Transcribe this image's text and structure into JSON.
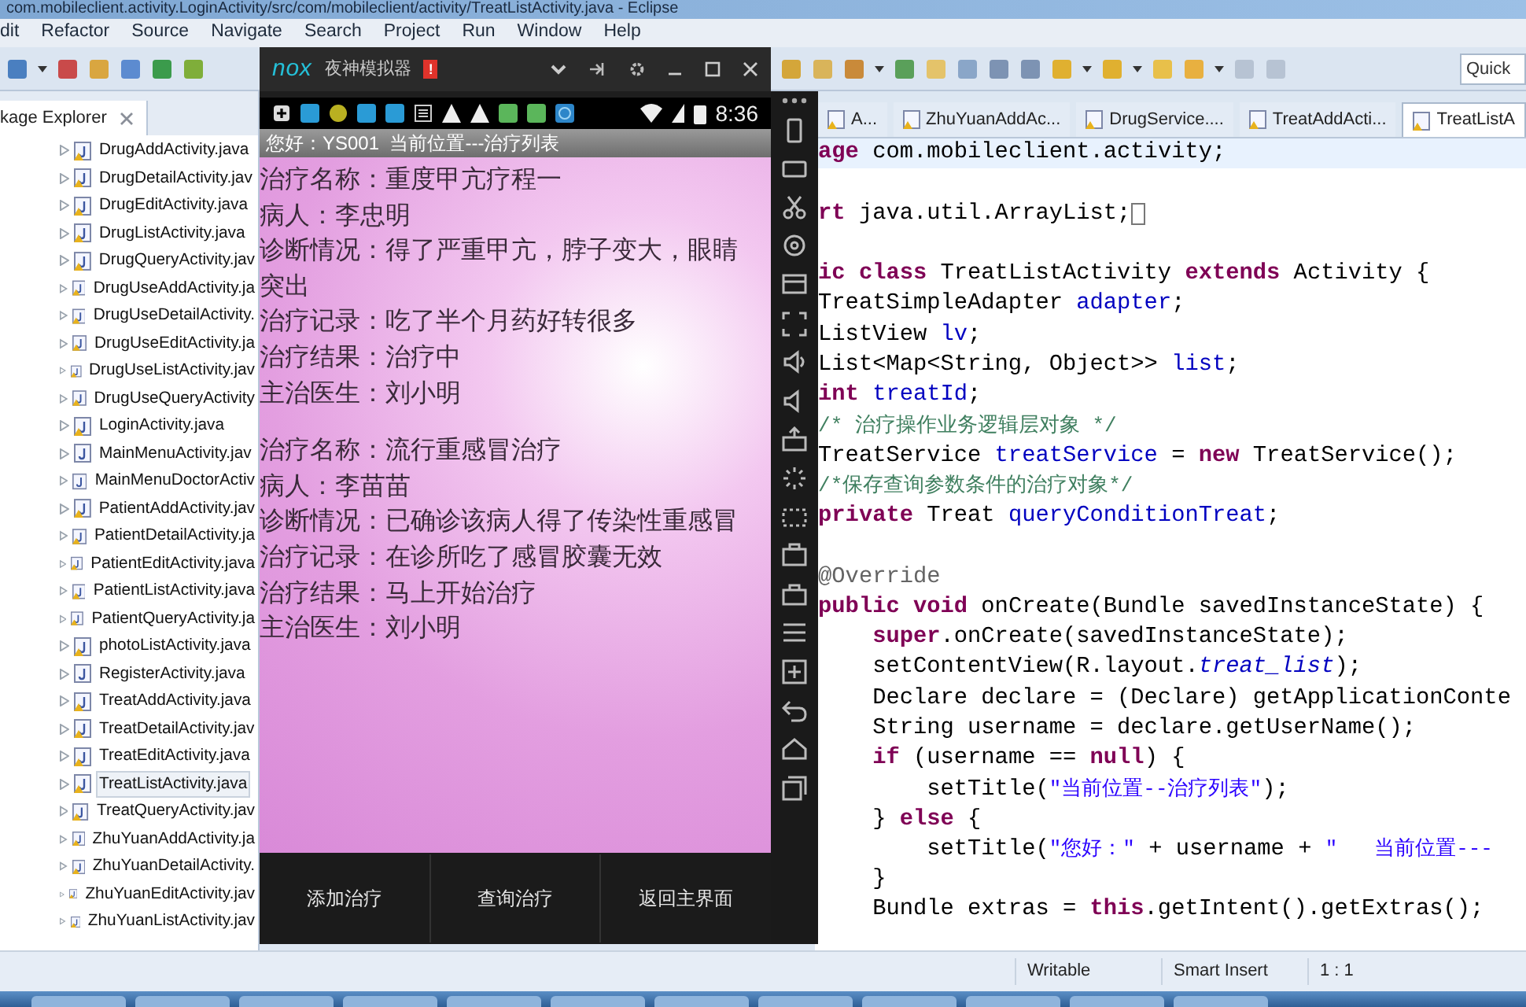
{
  "window": {
    "title": "com.mobileclient.activity.LoginActivity/src/com/mobileclient/activity/TreatListActivity.java - Eclipse"
  },
  "menu": [
    "dit",
    "Refactor",
    "Source",
    "Navigate",
    "Search",
    "Project",
    "Run",
    "Window",
    "Help"
  ],
  "toolbar": {
    "quick_access": {
      "placeholder": "Quick"
    }
  },
  "package_explorer": {
    "title": "kage Explorer",
    "items": [
      {
        "label": "DrugAddActivity.java",
        "selected": false,
        "warning": true
      },
      {
        "label": "DrugDetailActivity.jav",
        "selected": false,
        "warning": true
      },
      {
        "label": "DrugEditActivity.java",
        "selected": false,
        "warning": true
      },
      {
        "label": "DrugListActivity.java",
        "selected": false,
        "warning": true
      },
      {
        "label": "DrugQueryActivity.jav",
        "selected": false,
        "warning": true
      },
      {
        "label": "DrugUseAddActivity.ja",
        "selected": false,
        "warning": true
      },
      {
        "label": "DrugUseDetailActivity.",
        "selected": false,
        "warning": true
      },
      {
        "label": "DrugUseEditActivity.ja",
        "selected": false,
        "warning": true
      },
      {
        "label": "DrugUseListActivity.jav",
        "selected": false,
        "warning": true
      },
      {
        "label": "DrugUseQueryActivity",
        "selected": false,
        "warning": true
      },
      {
        "label": "LoginActivity.java",
        "selected": false,
        "warning": true
      },
      {
        "label": "MainMenuActivity.jav",
        "selected": false,
        "warning": false
      },
      {
        "label": "MainMenuDoctorActiv",
        "selected": false,
        "warning": false
      },
      {
        "label": "PatientAddActivity.jav",
        "selected": false,
        "warning": true
      },
      {
        "label": "PatientDetailActivity.ja",
        "selected": false,
        "warning": true
      },
      {
        "label": "PatientEditActivity.java",
        "selected": false,
        "warning": true
      },
      {
        "label": "PatientListActivity.java",
        "selected": false,
        "warning": true
      },
      {
        "label": "PatientQueryActivity.ja",
        "selected": false,
        "warning": true
      },
      {
        "label": "photoListActivity.java",
        "selected": false,
        "warning": true
      },
      {
        "label": "RegisterActivity.java",
        "selected": false,
        "warning": false
      },
      {
        "label": "TreatAddActivity.java",
        "selected": false,
        "warning": true
      },
      {
        "label": "TreatDetailActivity.jav",
        "selected": false,
        "warning": true
      },
      {
        "label": "TreatEditActivity.java",
        "selected": false,
        "warning": true
      },
      {
        "label": "TreatListActivity.java",
        "selected": true,
        "warning": true
      },
      {
        "label": "TreatQueryActivity.jav",
        "selected": false,
        "warning": true
      },
      {
        "label": "ZhuYuanAddActivity.ja",
        "selected": false,
        "warning": true
      },
      {
        "label": "ZhuYuanDetailActivity.",
        "selected": false,
        "warning": true
      },
      {
        "label": "ZhuYuanEditActivity.jav",
        "selected": false,
        "warning": true
      },
      {
        "label": "ZhuYuanListActivity.jav",
        "selected": false,
        "warning": true
      }
    ]
  },
  "editor": {
    "tabs": [
      {
        "label": "A...",
        "selected": false
      },
      {
        "label": "ZhuYuanAddAc...",
        "selected": false
      },
      {
        "label": "DrugService....",
        "selected": false
      },
      {
        "label": "TreatAddActi...",
        "selected": false
      },
      {
        "label": "TreatListA",
        "selected": true
      }
    ],
    "lines": [
      {
        "current": true,
        "tokens": [
          {
            "kind": "keyword",
            "text": "age"
          },
          {
            "kind": "plain",
            "text": " com.mobileclient.activity;"
          }
        ]
      },
      {
        "blank_before": true,
        "folded": true,
        "tokens": [
          {
            "kind": "keyword",
            "text": "rt"
          },
          {
            "kind": "plain",
            "text": " java.util.ArrayList;"
          }
        ]
      },
      {
        "blank_before": true,
        "tokens": [
          {
            "kind": "keyword",
            "text": "ic class"
          },
          {
            "kind": "plain",
            "text": " TreatListActivity "
          },
          {
            "kind": "keyword",
            "text": "extends"
          },
          {
            "kind": "plain",
            "text": " Activity {"
          }
        ]
      },
      {
        "tokens": [
          {
            "kind": "plain",
            "text": "TreatSimpleAdapter "
          },
          {
            "kind": "field",
            "text": "adapter"
          },
          {
            "kind": "plain",
            "text": ";"
          }
        ]
      },
      {
        "tokens": [
          {
            "kind": "plain",
            "text": "ListView "
          },
          {
            "kind": "field",
            "text": "lv"
          },
          {
            "kind": "plain",
            "text": ";"
          }
        ]
      },
      {
        "tokens": [
          {
            "kind": "plain",
            "text": "List<Map<String, Object>> "
          },
          {
            "kind": "field",
            "text": "list"
          },
          {
            "kind": "plain",
            "text": ";"
          }
        ]
      },
      {
        "tokens": [
          {
            "kind": "keyword",
            "text": "int"
          },
          {
            "kind": "field",
            "text": " treatId"
          },
          {
            "kind": "plain",
            "text": ";"
          }
        ]
      },
      {
        "tokens": [
          {
            "kind": "comment",
            "text": "/* 治疗操作业务逻辑层对象 */"
          }
        ]
      },
      {
        "tokens": [
          {
            "kind": "plain",
            "text": "TreatService "
          },
          {
            "kind": "field",
            "text": "treatService"
          },
          {
            "kind": "plain",
            "text": " = "
          },
          {
            "kind": "keyword",
            "text": "new"
          },
          {
            "kind": "plain",
            "text": " TreatService();"
          }
        ]
      },
      {
        "tokens": [
          {
            "kind": "comment",
            "text": "/*保存查询参数条件的治疗对象*/"
          }
        ]
      },
      {
        "tokens": [
          {
            "kind": "keyword",
            "text": "private"
          },
          {
            "kind": "plain",
            "text": " Treat "
          },
          {
            "kind": "field",
            "text": "queryConditionTreat"
          },
          {
            "kind": "plain",
            "text": ";"
          }
        ]
      },
      {
        "blank_before": true,
        "tokens": [
          {
            "kind": "annotation",
            "text": "@Override"
          }
        ]
      },
      {
        "tokens": [
          {
            "kind": "keyword",
            "text": "public void"
          },
          {
            "kind": "plain",
            "text": " onCreate(Bundle savedInstanceState) {"
          }
        ]
      },
      {
        "tokens": [
          {
            "kind": "keyword",
            "text": "    super"
          },
          {
            "kind": "plain",
            "text": ".onCreate(savedInstanceState);"
          }
        ]
      },
      {
        "tokens": [
          {
            "kind": "plain",
            "text": "    setContentView(R.layout."
          },
          {
            "kind": "static",
            "text": "treat_list"
          },
          {
            "kind": "plain",
            "text": ");"
          }
        ]
      },
      {
        "tokens": [
          {
            "kind": "plain",
            "text": "    Declare declare = (Declare) getApplicationConte"
          }
        ]
      },
      {
        "tokens": [
          {
            "kind": "plain",
            "text": "    String username = declare.getUserName();"
          }
        ]
      },
      {
        "tokens": [
          {
            "kind": "keyword",
            "text": "    if"
          },
          {
            "kind": "plain",
            "text": " (username == "
          },
          {
            "kind": "keyword",
            "text": "null"
          },
          {
            "kind": "plain",
            "text": ") {"
          }
        ]
      },
      {
        "tokens": [
          {
            "kind": "plain",
            "text": "        setTitle("
          },
          {
            "kind": "string",
            "text": "\"当前位置--治疗列表\""
          },
          {
            "kind": "plain",
            "text": ");"
          }
        ]
      },
      {
        "tokens": [
          {
            "kind": "plain",
            "text": "    } "
          },
          {
            "kind": "keyword",
            "text": "else"
          },
          {
            "kind": "plain",
            "text": " {"
          }
        ]
      },
      {
        "tokens": [
          {
            "kind": "plain",
            "text": "        setTitle("
          },
          {
            "kind": "string",
            "text": "\"您好：\""
          },
          {
            "kind": "plain",
            "text": " + username + "
          },
          {
            "kind": "string",
            "text": "\"   当前位置---"
          }
        ]
      },
      {
        "tokens": [
          {
            "kind": "plain",
            "text": "    }"
          }
        ]
      },
      {
        "tokens": [
          {
            "kind": "plain",
            "text": "    Bundle extras = "
          },
          {
            "kind": "keyword",
            "text": "this"
          },
          {
            "kind": "plain",
            "text": ".getIntent().getExtras();"
          }
        ]
      }
    ]
  },
  "emulator": {
    "logo": "nox",
    "title": "夜神模拟器",
    "badge": "!",
    "status_bar": {
      "time": "8:36"
    },
    "app_title": "您好：YS001  当前位置---治疗列表",
    "records": [
      {
        "lines": [
          "治疗名称：重度甲亢疗程一",
          "病人：李忠明",
          "诊断情况：得了严重甲亢，脖子变大，眼睛突出",
          "治疗记录：吃了半个月药好转很多",
          "治疗结果：治疗中",
          "主治医生：刘小明"
        ]
      },
      {
        "lines": [
          "治疗名称：流行重感冒治疗",
          "病人：李苗苗",
          "诊断情况：已确诊该病人得了传染性重感冒",
          "治疗记录：在诊所吃了感冒胶囊无效",
          "治疗结果：马上开始治疗",
          "主治医生：刘小明"
        ]
      }
    ],
    "buttons": [
      "添加治疗",
      "查询治疗",
      "返回主界面"
    ]
  },
  "status_bar": {
    "fields": [
      "Writable",
      "Smart Insert",
      "1 : 1"
    ]
  }
}
